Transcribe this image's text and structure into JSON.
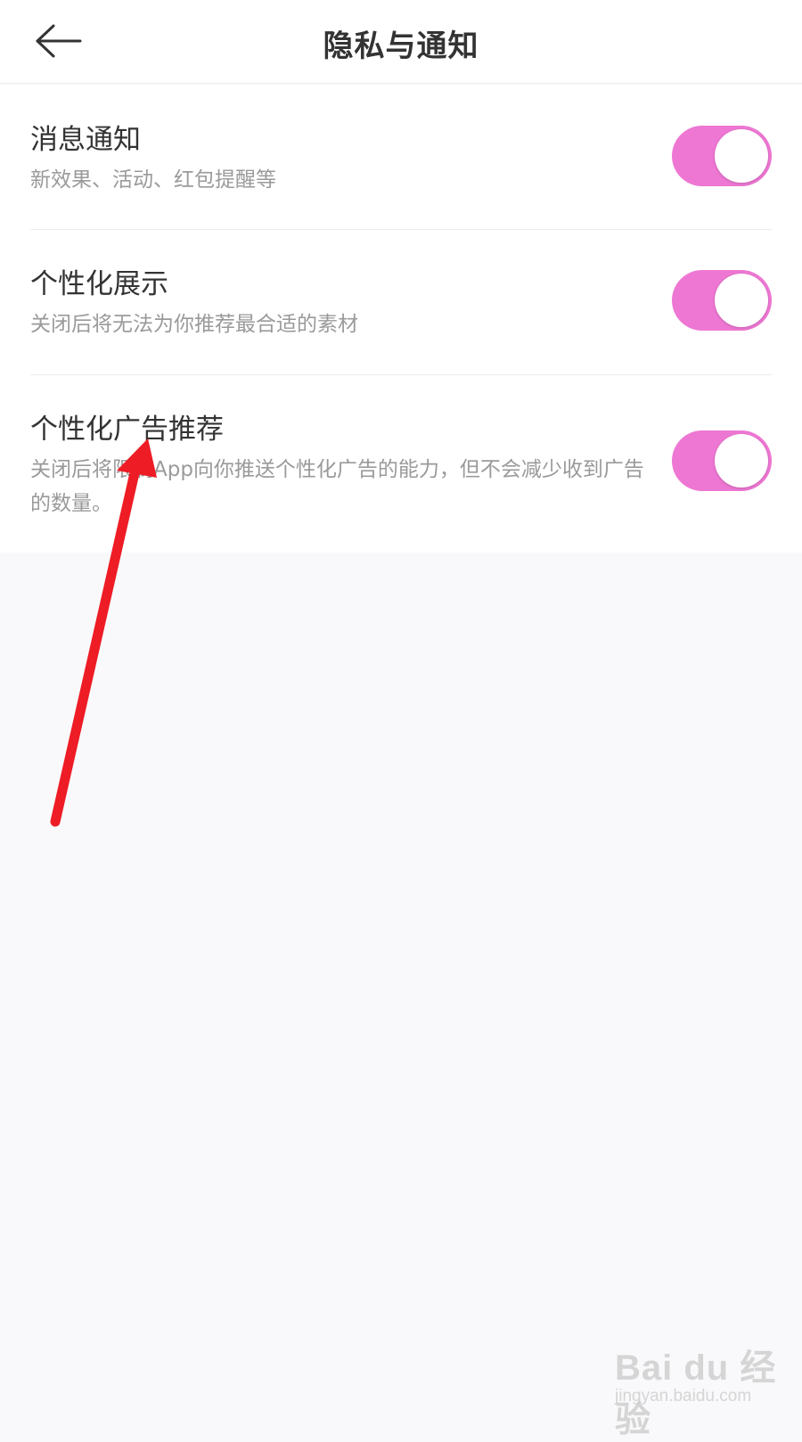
{
  "header": {
    "title": "隐私与通知",
    "back_icon": "arrow-left-icon"
  },
  "settings": [
    {
      "title": "消息通知",
      "description": "新效果、活动、红包提醒等",
      "enabled": true
    },
    {
      "title": "个性化展示",
      "description": "关闭后将无法为你推荐最合适的素材",
      "enabled": true
    },
    {
      "title": "个性化广告推荐",
      "description": "关闭后将限制App向你推送个性化广告的能力，但不会减少收到广告的数量。",
      "enabled": true
    }
  ],
  "colors": {
    "toggle_on": "#ee77d3",
    "background": "#f9f9fb",
    "annotation_arrow": "#ee1c25"
  },
  "watermark": {
    "brand": "Bai du 经验",
    "url": "jingyan.baidu.com"
  }
}
